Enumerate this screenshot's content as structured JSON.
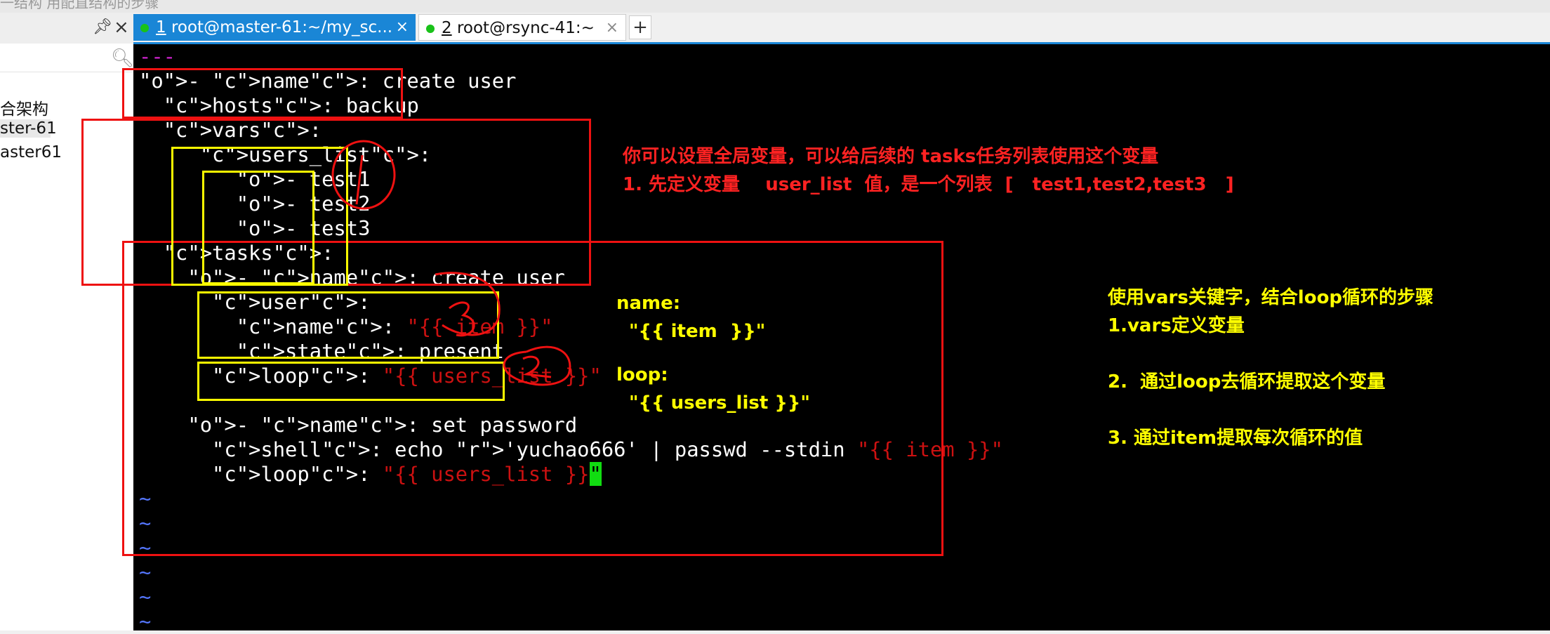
{
  "window": {
    "top_text": "一结构 用配直结构的步骤"
  },
  "left_panel": {
    "items": [
      "合架构",
      "ster-61",
      "aster61"
    ]
  },
  "tabs": [
    {
      "num": "1",
      "label": " root@master-61:~/my_sc..."
    },
    {
      "num": "2",
      "label": " root@rsync-41:~"
    }
  ],
  "tab_add": "+",
  "terminal_lines": [
    "---",
    "- name: create user",
    "  hosts: backup",
    "  vars:",
    "     users_list:",
    "        - test1",
    "        - test2",
    "        - test3",
    "  tasks:",
    "    - name: create user",
    "      user:",
    "        name: \"{{ item }}\"",
    "        state: present",
    "      loop: \"{{ users_list }}\"",
    "",
    "    - name: set password",
    "      shell: echo 'yuchao666' | passwd --stdin \"{{ item }}\"",
    "      loop: \"{{ users_list }}\"",
    "~",
    "~",
    "~",
    "~",
    "~",
    "~"
  ],
  "annotations": {
    "red_note_1": "你可以设置全局变量，可以给后续的 tasks任务列表使用这个变量",
    "red_note_2": "1. 先定义变量    user_list  值，是一个列表  [   test1,test2,test3   ]",
    "yellow_name_label": "name:",
    "yellow_name_value": "\"{{ item  }}\"",
    "yellow_loop_label": "loop:",
    "yellow_loop_value": "\"{{ users_list }}\"",
    "right_1": "使用vars关键字，结合loop循环的步骤",
    "right_2": "1.vars定义变量",
    "right_3": "2.  通过loop去循环提取这个变量",
    "right_4": "3. 通过item提取每次循环的值"
  },
  "colors": {
    "tab_active": "#1a86d6",
    "terminal_bg": "#000000",
    "yaml_key": "#22c8c8",
    "yaml_string": "#cc1111",
    "annotation_red": "#ff2222",
    "annotation_yellow": "#ffff00",
    "cursor": "#11dd11"
  }
}
